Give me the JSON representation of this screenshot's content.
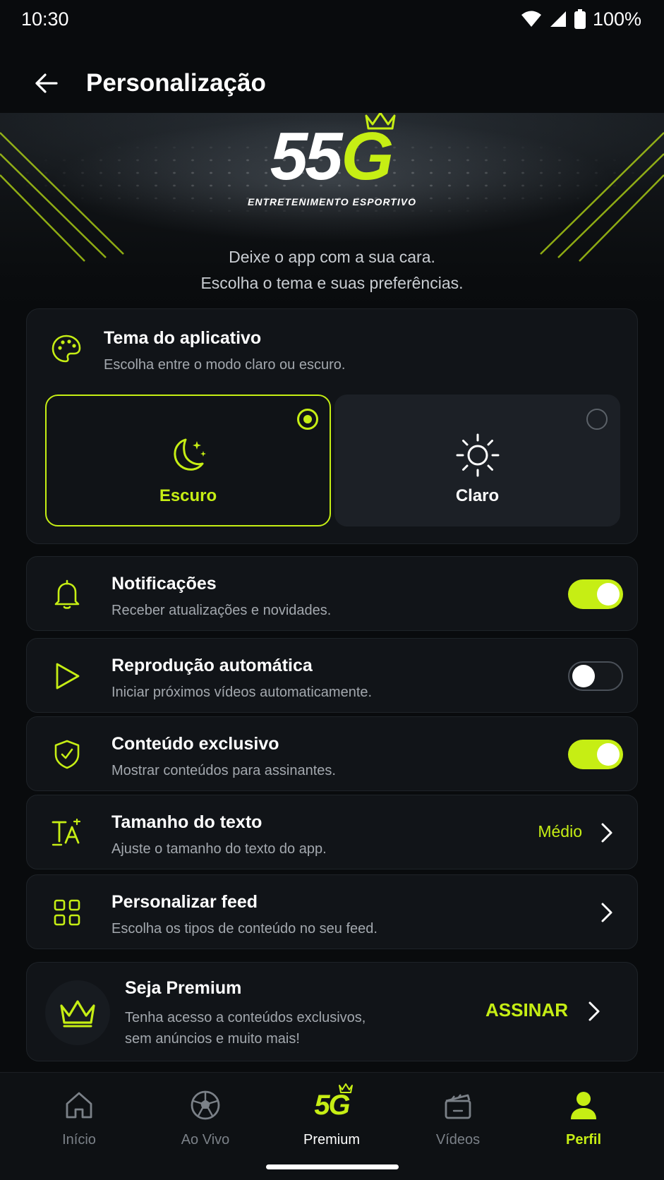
{
  "status_bar": {
    "time": "10:30",
    "battery": "100%"
  },
  "app_bar": {
    "title": "Personalização"
  },
  "hero": {
    "logo_main": "55",
    "logo_accent": "G",
    "logo_sub_a": "ENTRETENIMENTO",
    "logo_sub_b": "ESPORTIVO",
    "tagline_1": "Deixe o app com a sua cara.",
    "tagline_2": "Escolha o tema e suas preferências."
  },
  "theme": {
    "title": "Tema do aplicativo",
    "subtitle": "Escolha entre o modo claro ou escuro.",
    "options": [
      {
        "label": "Escuro",
        "selected": true
      },
      {
        "label": "Claro",
        "selected": false
      }
    ]
  },
  "settings": [
    {
      "title": "Notificações",
      "subtitle": "Receber atualizações e novidades.",
      "icon": "bell-icon",
      "toggle": true
    },
    {
      "title": "Reprodução automática",
      "subtitle": "Iniciar próximos vídeos automaticamente.",
      "icon": "play-icon",
      "toggle": false
    },
    {
      "title": "Conteúdo exclusivo",
      "subtitle": "Mostrar conteúdos para assinantes.",
      "icon": "shield-icon",
      "toggle": true
    },
    {
      "title": "Tamanho do texto",
      "subtitle": "Ajuste o tamanho do texto do app.",
      "icon": "text-size-icon",
      "value": "Médio"
    },
    {
      "title": "Personalizar feed",
      "subtitle": "Escolha os tipos de conteúdo no seu feed.",
      "icon": "grid-icon"
    }
  ],
  "premium": {
    "title": "Seja Premium",
    "subtitle": "Tenha acesso a conteúdos exclusivos, sem anúncios e muito mais!",
    "cta": "ASSINAR"
  },
  "nav": {
    "items": [
      {
        "label": "Início",
        "icon": "home-icon"
      },
      {
        "label": "Ao Vivo",
        "icon": "soccer-ball-icon"
      },
      {
        "label": "Premium",
        "icon": "logo-icon",
        "logo": "5G"
      },
      {
        "label": "Vídeos",
        "icon": "clapperboard-icon"
      },
      {
        "label": "Perfil",
        "icon": "person-icon",
        "active": true
      }
    ]
  },
  "colors": {
    "accent": "#c6ee14",
    "background": "#090b0d",
    "card": "#111418"
  }
}
